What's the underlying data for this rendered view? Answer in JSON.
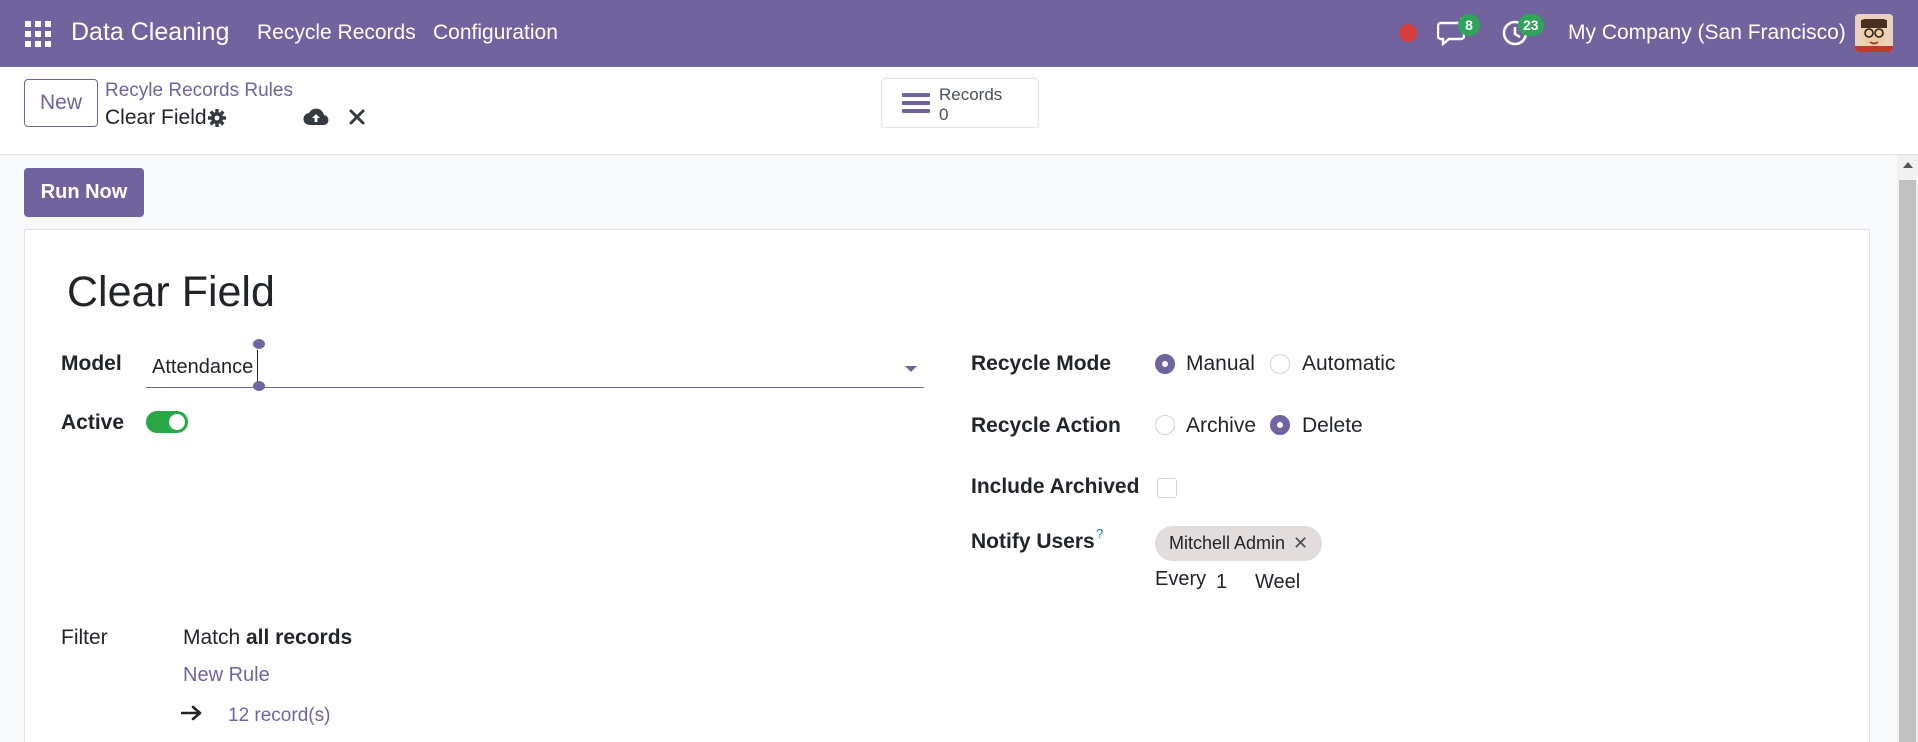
{
  "navbar": {
    "app_name": "Data Cleaning",
    "menu": [
      "Recycle Records",
      "Configuration"
    ],
    "messages_badge": "8",
    "activities_badge": "23",
    "company": "My Company (San Francisco)"
  },
  "control": {
    "new_label": "New",
    "breadcrumb_parent": "Recyle Records Rules",
    "breadcrumb_current": "Clear Field",
    "smart_button": {
      "label": "Records",
      "value": "0"
    }
  },
  "actions": {
    "run_now": "Run Now"
  },
  "form": {
    "title": "Clear Field",
    "model": {
      "label": "Model",
      "value": "Attendance"
    },
    "active": {
      "label": "Active",
      "value": true
    },
    "recycle_mode": {
      "label": "Recycle Mode",
      "options": [
        "Manual",
        "Automatic"
      ],
      "selected": "Manual"
    },
    "recycle_action": {
      "label": "Recycle Action",
      "options": [
        "Archive",
        "Delete"
      ],
      "selected": "Delete"
    },
    "include_archived": {
      "label": "Include Archived",
      "value": false
    },
    "notify_users": {
      "label": "Notify Users",
      "help": "?",
      "tags": [
        "Mitchell Admin"
      ]
    },
    "every": {
      "label": "Every",
      "number": "1",
      "unit": "Weel"
    },
    "filter": {
      "label": "Filter",
      "match_prefix": "Match",
      "match_bold": "all records",
      "new_rule": "New Rule",
      "records": "12 record(s)"
    }
  },
  "colors": {
    "brand": "#71639e",
    "toggle_on": "#28a745",
    "badge": "#2fa55a",
    "record_dot": "#d63d3d"
  }
}
